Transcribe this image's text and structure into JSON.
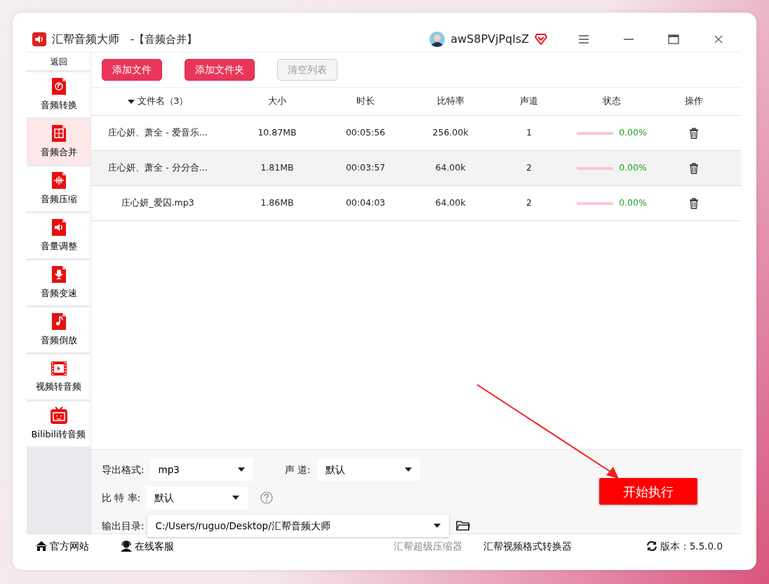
{
  "window": {
    "app_name": "汇帮音频大师",
    "title": "-【音频合并】",
    "user": "awS8PVjPqlsZ"
  },
  "sidebar": {
    "back": "返回",
    "items": [
      {
        "label": "音频转换",
        "kind": "convert",
        "selected": false
      },
      {
        "label": "音频合并",
        "kind": "merge",
        "selected": true
      },
      {
        "label": "音频压缩",
        "kind": "compress",
        "selected": false
      },
      {
        "label": "音量调整",
        "kind": "volume",
        "selected": false
      },
      {
        "label": "音频变速",
        "kind": "speed",
        "selected": false
      },
      {
        "label": "音频倒放",
        "kind": "reverse",
        "selected": false
      },
      {
        "label": "视频转音频",
        "kind": "video",
        "selected": false
      },
      {
        "label": "Bilibili转音频",
        "kind": "tv",
        "selected": false
      }
    ]
  },
  "toolbar": [
    {
      "label": "添加文件",
      "disabled": false
    },
    {
      "label": "添加文件夹",
      "disabled": false
    },
    {
      "label": "清空列表",
      "disabled": true
    }
  ],
  "table": {
    "columns": [
      {
        "label": "文件名（3）",
        "sorted": true
      },
      {
        "label": "大小",
        "sorted": false
      },
      {
        "label": "时长",
        "sorted": false
      },
      {
        "label": "比特率",
        "sorted": false
      },
      {
        "label": "声道",
        "sorted": false
      },
      {
        "label": "状态",
        "sorted": false
      },
      {
        "label": "操作",
        "sorted": false
      }
    ],
    "rows": [
      {
        "name": "庄心妍、萧全 - 爱音乐...",
        "size": "10.87MB",
        "duration": "00:05:56",
        "bitrate": "256.00k",
        "channels": "1",
        "level": 0,
        "progress": "0.00%",
        "selected": false
      },
      {
        "name": "庄心妍、萧全 - 分分合...",
        "size": "1.81MB",
        "duration": "00:03:57",
        "bitrate": "64.00k",
        "channels": "2",
        "level": 0,
        "progress": "0.00%",
        "selected": true
      },
      {
        "name": "庄心妍_爱囚.mp3",
        "size": "1.86MB",
        "duration": "00:04:03",
        "bitrate": "64.00k",
        "channels": "2",
        "level": 0,
        "progress": "0.00%",
        "selected": false
      }
    ]
  },
  "settings": {
    "format": {
      "label": "导出格式:",
      "value": "mp3"
    },
    "channel": {
      "label": "声 道:",
      "value": "默认"
    },
    "bitrate": {
      "label": "比 特 率:",
      "value": "默认"
    },
    "output": {
      "label": "输出目录:",
      "value": "C:/Users/ruguo/Desktop/汇帮音频大师"
    },
    "start": "开始执行"
  },
  "footer": {
    "website": "官方网站",
    "support": "在线客服",
    "links": [
      {
        "label": "汇帮超级压缩器",
        "muted": true
      },
      {
        "label": "汇帮视频格式转换器",
        "muted": false
      }
    ],
    "version": "版本：5.5.0.0"
  }
}
